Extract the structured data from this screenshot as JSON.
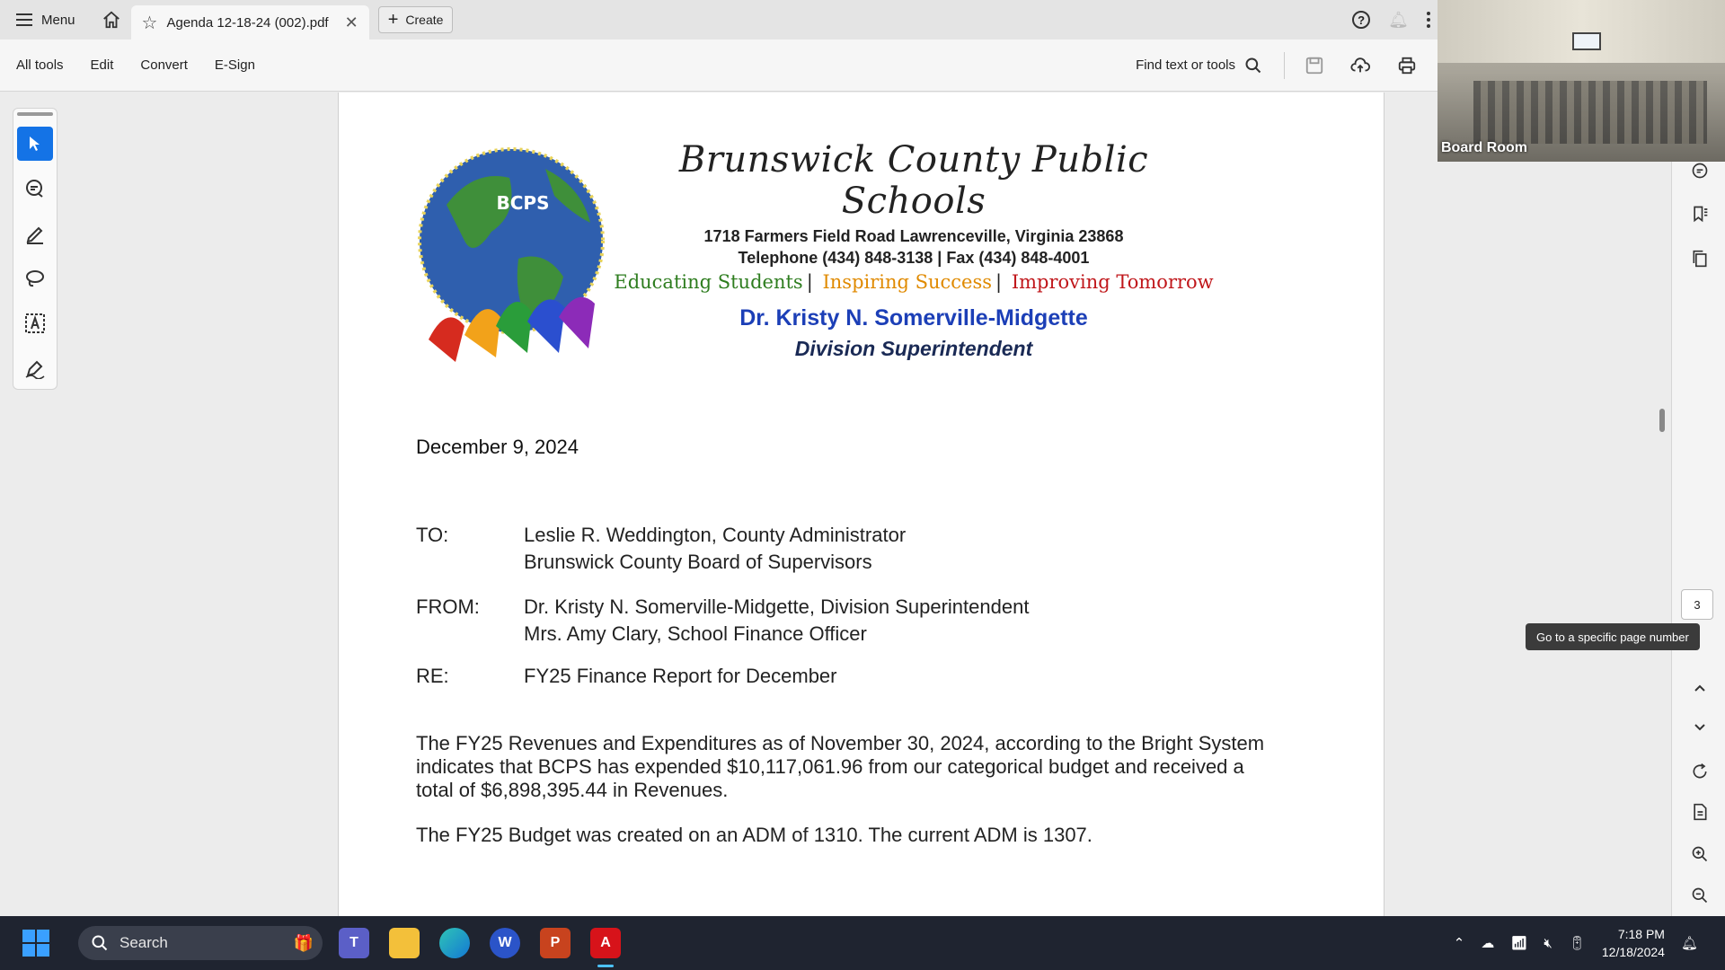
{
  "tabbar": {
    "menu_label": "Menu",
    "tab_title": "Agenda 12-18-24 (002).pdf",
    "create_label": "Create"
  },
  "toolbar": {
    "items": [
      "All tools",
      "Edit",
      "Convert",
      "E-Sign"
    ],
    "find_label": "Find text or tools"
  },
  "letterhead": {
    "org_name": "Brunswick County Public Schools",
    "address": "1718 Farmers Field Road Lawrenceville, Virginia 23868",
    "phone": "Telephone (434) 848-3138 |  Fax (434) 848-4001",
    "motto": [
      "Educating Students",
      "Inspiring Success",
      "Improving Tomorrow"
    ],
    "superintendent": "Dr. Kristy N. Somerville-Midgette",
    "super_title": "Division Superintendent",
    "logo_text": "BCPS"
  },
  "memo": {
    "date": "December 9, 2024",
    "to_label": "TO:",
    "to_lines": [
      "Leslie R. Weddington, County Administrator",
      "Brunswick County Board of Supervisors"
    ],
    "from_label": "FROM:",
    "from_lines": [
      "Dr. Kristy N. Somerville-Midgette, Division Superintendent",
      "Mrs. Amy Clary, School Finance Officer"
    ],
    "re_label": "RE:",
    "re_line": "FY25 Finance Report for December",
    "para1": "The FY25 Revenues and Expenditures as of November 30, 2024, according to the Bright System indicates that BCPS has expended $10,117,061.96 from our categorical budget and received a total of $6,898,395.44 in Revenues.",
    "para2": "The FY25 Budget was created on an ADM of 1310.  The current ADM is 1307."
  },
  "side": {
    "page_number": "3",
    "tooltip": "Go to a specific page number"
  },
  "video": {
    "caption": "Board Room"
  },
  "taskbar": {
    "search_placeholder": "Search",
    "time": "7:18 PM",
    "date": "12/18/2024"
  },
  "colors": {
    "accent": "#1473e6",
    "taskbar": "#1f2430",
    "motto_green": "#2e7d1f",
    "motto_orange": "#e08a00",
    "motto_red": "#c0171b",
    "superintendent_blue": "#1c3fb7"
  }
}
